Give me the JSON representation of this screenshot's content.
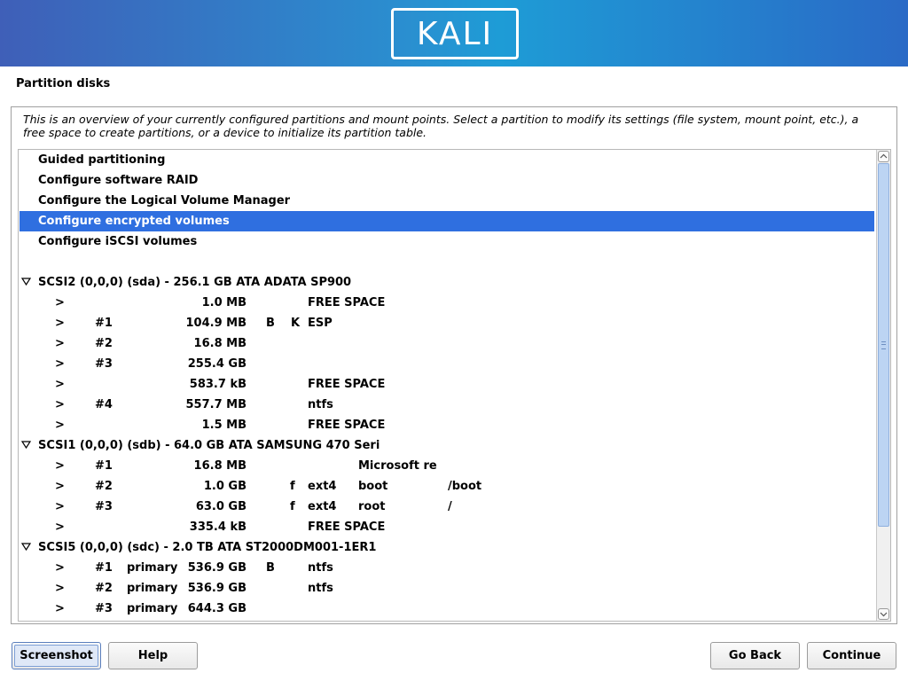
{
  "banner": {
    "logo_text": "KALI"
  },
  "page": {
    "title": "Partition disks"
  },
  "description": "This is an overview of your currently configured partitions and mount points. Select a partition to modify its settings (file system, mount point, etc.), a free space to create partitions, or a device to initialize its partition table.",
  "colors": {
    "selected_row": "#2f6fe0",
    "banner_start": "#3f5fb8",
    "banner_end": "#2a6ac6"
  },
  "actions": [
    {
      "label": "Guided partitioning"
    },
    {
      "label": "Configure software RAID"
    },
    {
      "label": "Configure the Logical Volume Manager"
    },
    {
      "label": "Configure encrypted volumes",
      "selected": true
    },
    {
      "label": "Configure iSCSI volumes"
    }
  ],
  "disks": [
    {
      "label": "SCSI2 (0,0,0) (sda) - 256.1 GB ATA ADATA SP900",
      "partitions": [
        {
          "arrow": ">",
          "num": "",
          "type": "",
          "size": "1.0 MB",
          "b": "",
          "k": "",
          "f": "",
          "fs": "FREE SPACE",
          "name": "",
          "mount": ""
        },
        {
          "arrow": ">",
          "num": "#1",
          "type": "",
          "size": "104.9 MB",
          "b": "B",
          "k": "K",
          "f": "",
          "fs": "ESP",
          "name": "",
          "mount": ""
        },
        {
          "arrow": ">",
          "num": "#2",
          "type": "",
          "size": "16.8 MB",
          "b": "",
          "k": "",
          "f": "",
          "fs": "",
          "name": "",
          "mount": ""
        },
        {
          "arrow": ">",
          "num": "#3",
          "type": "",
          "size": "255.4 GB",
          "b": "",
          "k": "",
          "f": "",
          "fs": "",
          "name": "",
          "mount": ""
        },
        {
          "arrow": ">",
          "num": "",
          "type": "",
          "size": "583.7 kB",
          "b": "",
          "k": "",
          "f": "",
          "fs": "FREE SPACE",
          "name": "",
          "mount": ""
        },
        {
          "arrow": ">",
          "num": "#4",
          "type": "",
          "size": "557.7 MB",
          "b": "",
          "k": "",
          "f": "",
          "fs": "ntfs",
          "name": "",
          "mount": ""
        },
        {
          "arrow": ">",
          "num": "",
          "type": "",
          "size": "1.5 MB",
          "b": "",
          "k": "",
          "f": "",
          "fs": "FREE SPACE",
          "name": "",
          "mount": ""
        }
      ]
    },
    {
      "label": "SCSI1 (0,0,0) (sdb) - 64.0 GB ATA SAMSUNG 470 Seri",
      "partitions": [
        {
          "arrow": ">",
          "num": "#1",
          "type": "",
          "size": "16.8 MB",
          "b": "",
          "k": "",
          "f": "",
          "fs": "",
          "name": "Microsoft re",
          "mount": ""
        },
        {
          "arrow": ">",
          "num": "#2",
          "type": "",
          "size": "1.0 GB",
          "b": "",
          "k": "",
          "f": "f",
          "fs": "ext4",
          "name": "boot",
          "mount": "/boot"
        },
        {
          "arrow": ">",
          "num": "#3",
          "type": "",
          "size": "63.0 GB",
          "b": "",
          "k": "",
          "f": "f",
          "fs": "ext4",
          "name": "root",
          "mount": "/"
        },
        {
          "arrow": ">",
          "num": "",
          "type": "",
          "size": "335.4 kB",
          "b": "",
          "k": "",
          "f": "",
          "fs": "FREE SPACE",
          "name": "",
          "mount": ""
        }
      ]
    },
    {
      "label": "SCSI5 (0,0,0) (sdc) - 2.0 TB ATA ST2000DM001-1ER1",
      "partitions": [
        {
          "arrow": ">",
          "num": "#1",
          "type": "primary",
          "size": "536.9 GB",
          "b": "B",
          "k": "",
          "f": "",
          "fs": "ntfs",
          "name": "",
          "mount": ""
        },
        {
          "arrow": ">",
          "num": "#2",
          "type": "primary",
          "size": "536.9 GB",
          "b": "",
          "k": "",
          "f": "",
          "fs": "ntfs",
          "name": "",
          "mount": ""
        },
        {
          "arrow": ">",
          "num": "#3",
          "type": "primary",
          "size": "644.3 GB",
          "b": "",
          "k": "",
          "f": "",
          "fs": "",
          "name": "",
          "mount": ""
        }
      ]
    }
  ],
  "buttons": {
    "screenshot": "Screenshot",
    "help": "Help",
    "go_back": "Go Back",
    "continue": "Continue"
  }
}
